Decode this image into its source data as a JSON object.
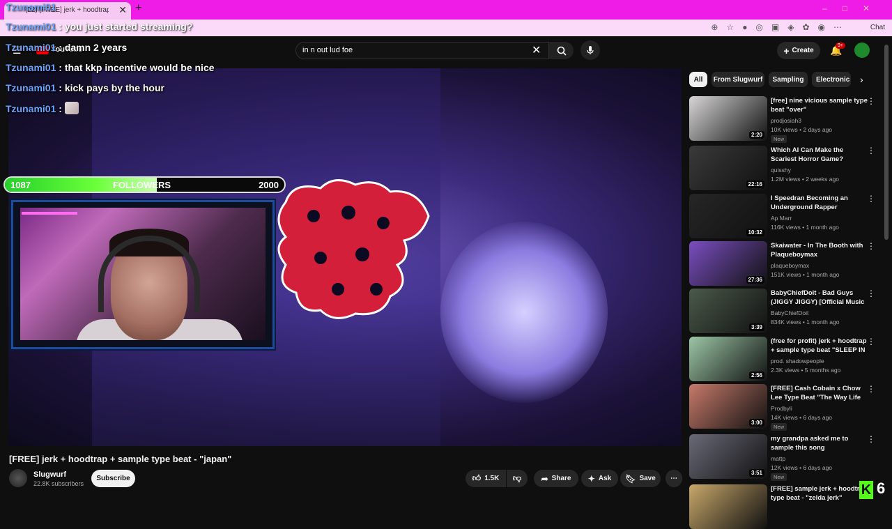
{
  "browser": {
    "tab_title": "(22) [FREE] jerk + hoodtrap + sample...",
    "chat_label": "Chat"
  },
  "header": {
    "logo_text": "YouTube",
    "search_value": "in n out lud foe",
    "create_label": "Create",
    "notif_count": "9+"
  },
  "chat": {
    "top_user": "Tzunami01",
    "lines": [
      {
        "user": "Tzunami01",
        "text": "you just started streaming?"
      },
      {
        "user": "Tzunami01",
        "text": "damn 2 years"
      },
      {
        "user": "Tzunami01",
        "text": "that kkp incentive would be nice"
      },
      {
        "user": "Tzunami01",
        "text": "kick pays by the hour"
      },
      {
        "user": "Tzunami01",
        "text": ""
      }
    ]
  },
  "followers": {
    "current": "1087",
    "label": "FOLLOWERS",
    "goal": "2000",
    "progress": 0.5435
  },
  "video": {
    "title": "[FREE] jerk + hoodtrap + sample type beat - \"japan\"",
    "channel": "Slugwurf",
    "subscribers": "22.8K subscribers",
    "subscribe_label": "Subscribe",
    "likes": "1.5K",
    "share_label": "Share",
    "ask_label": "Ask",
    "save_label": "Save"
  },
  "chips": [
    "All",
    "From Slugwurf",
    "Sampling",
    "Electronic M"
  ],
  "recommendations": [
    {
      "title": "[free] nine vicious sample type beat \"over\"",
      "channel": "prodjosiah3",
      "meta": "10K views • 2 days ago",
      "duration": "2:20",
      "badge": "New",
      "thumb": "#d8d6d6"
    },
    {
      "title": "Which AI Can Make the Scariest Horror Game?",
      "channel": "quisshy",
      "meta": "1.2M views • 2 weeks ago",
      "duration": "22:16",
      "badge": "",
      "thumb": "#3a3a3a"
    },
    {
      "title": "I Speedran Becoming an Underground Rapper",
      "channel": "Ap Marr",
      "meta": "116K views • 1 month ago",
      "duration": "10:32",
      "badge": "",
      "thumb": "#262626"
    },
    {
      "title": "Skaiwater - In The Booth with Plaqueboymax",
      "channel": "plaqueboymax",
      "meta": "151K views • 1 month ago",
      "duration": "27:36",
      "badge": "",
      "thumb": "#7a4ec0"
    },
    {
      "title": "BabyChiefDoit - Bad Guys (JIGGY JIGGY) [Official Music ...",
      "channel": "BabyChiefDoit",
      "meta": "834K views • 1 month ago",
      "duration": "3:39",
      "badge": "",
      "thumb": "#4a5a4a"
    },
    {
      "title": "(free for profit) jerk + hoodtrap + sample type beat \"SLEEP IN ...",
      "channel": "prod. shadowpeople",
      "meta": "2.3K views • 5 months ago",
      "duration": "2:56",
      "badge": "",
      "thumb": "#9cc6a6"
    },
    {
      "title": "[FREE] Cash Cobain x Chow Lee Type Beat \"The Way Life Goes\"",
      "channel": "Prodbyli",
      "meta": "14K views • 6 days ago",
      "duration": "3:00",
      "badge": "New",
      "thumb": "#c77a6a"
    },
    {
      "title": "my grandpa asked me to sample this song",
      "channel": "mattp",
      "meta": "12K views • 6 days ago",
      "duration": "3:51",
      "badge": "New",
      "thumb": "#6a6a78"
    },
    {
      "title": "[FREE] sample jerk + hoodtrap type beat - \"zelda jerk\"",
      "channel": "",
      "meta": "",
      "duration": "",
      "badge": "",
      "thumb": "#c9a86a"
    }
  ],
  "kick": {
    "count": "6"
  }
}
